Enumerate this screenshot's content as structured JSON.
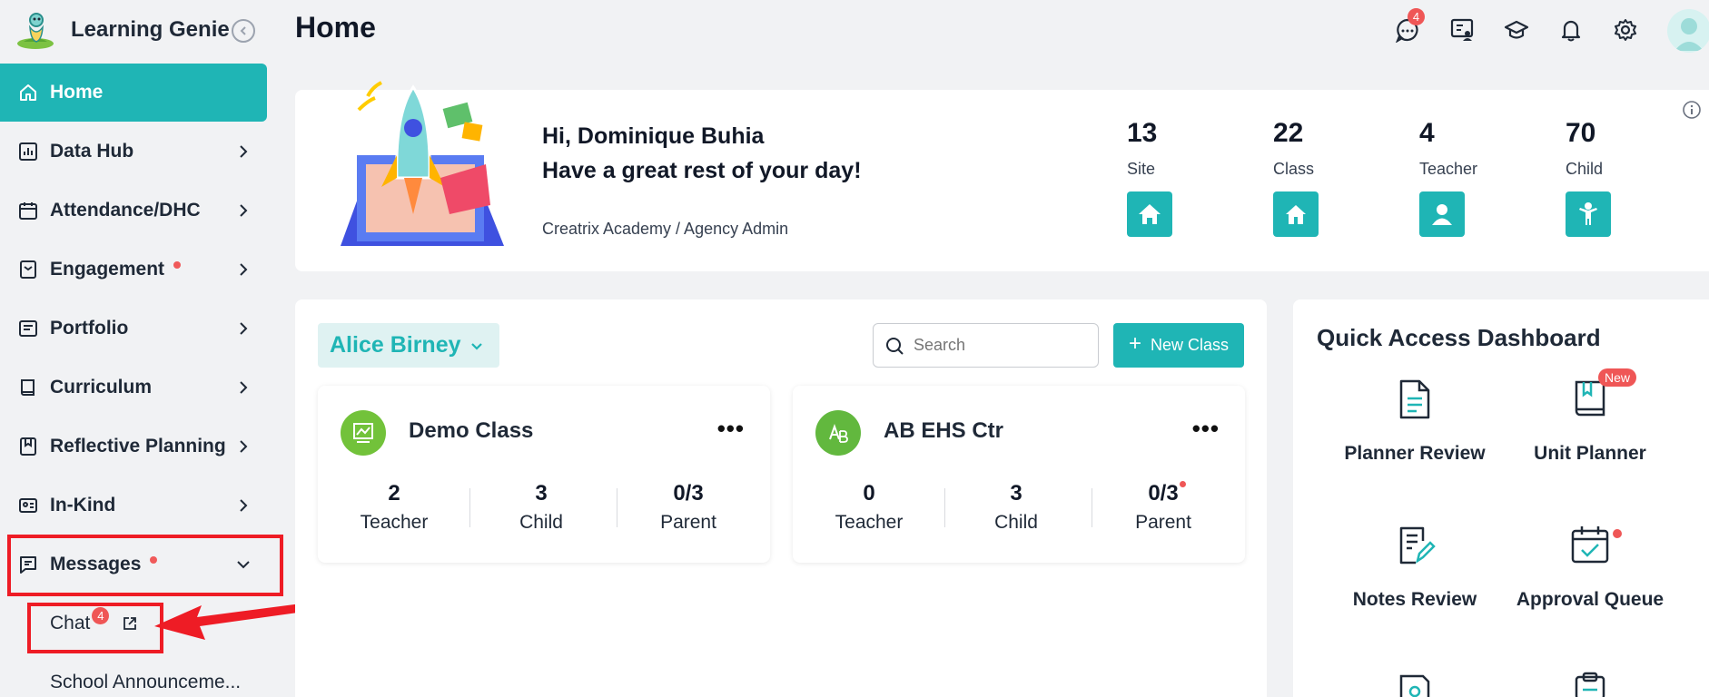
{
  "app": {
    "name": "Learning Genie"
  },
  "header": {
    "title": "Home",
    "chat_badge": "4"
  },
  "sidebar": {
    "items": [
      {
        "label": "Home"
      },
      {
        "label": "Data Hub"
      },
      {
        "label": "Attendance/DHC"
      },
      {
        "label": "Engagement"
      },
      {
        "label": "Portfolio"
      },
      {
        "label": "Curriculum"
      },
      {
        "label": "Reflective Planning"
      },
      {
        "label": "In-Kind"
      },
      {
        "label": "Messages"
      }
    ],
    "sub_items": [
      {
        "label": "Chat",
        "badge": "4"
      },
      {
        "label": "School Announceme..."
      }
    ]
  },
  "welcome": {
    "greeting": "Hi, Dominique Buhia",
    "message": "Have a great rest of your day!",
    "org": "Creatrix Academy / Agency Admin",
    "stats": [
      {
        "value": "13",
        "label": "Site"
      },
      {
        "value": "22",
        "label": "Class"
      },
      {
        "value": "4",
        "label": "Teacher"
      },
      {
        "value": "70",
        "label": "Child"
      }
    ]
  },
  "classes": {
    "teacher": "Alice Birney",
    "search_placeholder": "Search",
    "new_class": "New Class",
    "cards": [
      {
        "name": "Demo Class",
        "teacher": "2",
        "child": "3",
        "parent": "0/3",
        "teacher_label": "Teacher",
        "child_label": "Child",
        "parent_label": "Parent"
      },
      {
        "name": "AB EHS Ctr",
        "teacher": "0",
        "child": "3",
        "parent": "0/3",
        "teacher_label": "Teacher",
        "child_label": "Child",
        "parent_label": "Parent"
      }
    ]
  },
  "quick_access": {
    "title": "Quick Access Dashboard",
    "new_badge": "New",
    "items": [
      {
        "label": "Planner Review"
      },
      {
        "label": "Unit Planner"
      },
      {
        "label": "Notes Review"
      },
      {
        "label": "Approval Queue"
      }
    ]
  },
  "colors": {
    "accent": "#1fb5b5",
    "alert": "#ef5656",
    "highlight": "#ee1c25"
  }
}
